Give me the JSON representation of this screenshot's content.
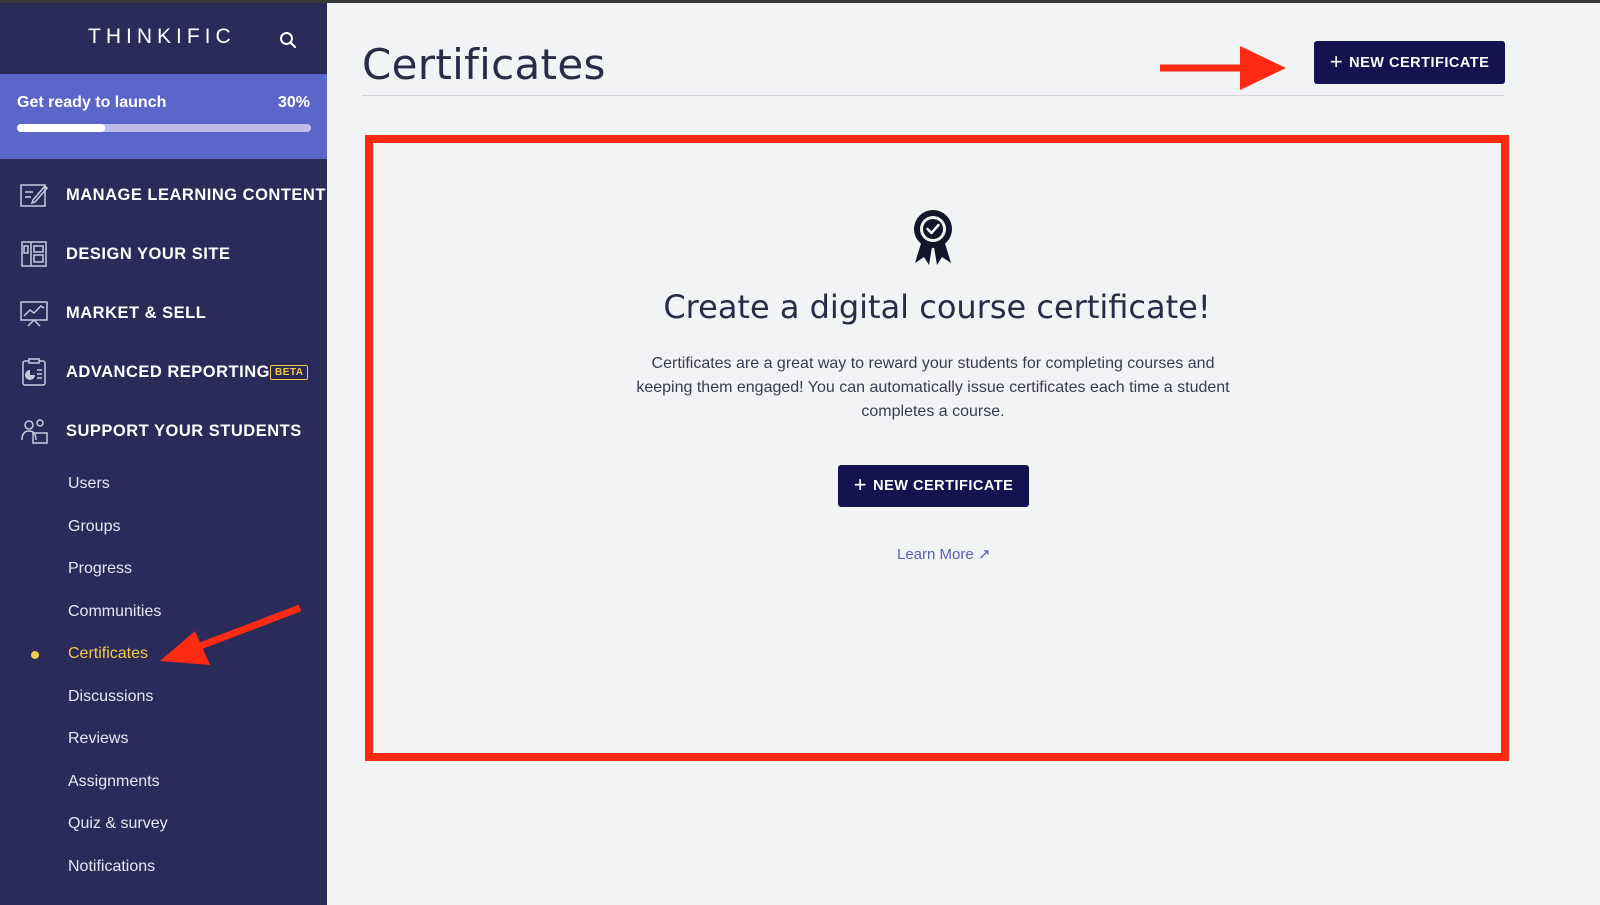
{
  "brand": "THINKIFIC",
  "launch": {
    "label": "Get ready to launch",
    "percent_text": "30%",
    "progress": 0.3
  },
  "nav": {
    "items": [
      {
        "label": "MANAGE LEARNING CONTENT",
        "icon": "edit-content-icon"
      },
      {
        "label": "DESIGN YOUR SITE",
        "icon": "layout-icon"
      },
      {
        "label": "MARKET & SELL",
        "icon": "chart-presentation-icon"
      },
      {
        "label": "ADVANCED REPORTING",
        "icon": "clipboard-report-icon",
        "badge": "BETA"
      },
      {
        "label": "SUPPORT YOUR STUDENTS",
        "icon": "students-icon"
      }
    ]
  },
  "subnav": {
    "items": [
      {
        "label": "Users"
      },
      {
        "label": "Groups"
      },
      {
        "label": "Progress"
      },
      {
        "label": "Communities"
      },
      {
        "label": "Certificates",
        "active": true
      },
      {
        "label": "Discussions"
      },
      {
        "label": "Reviews"
      },
      {
        "label": "Assignments"
      },
      {
        "label": "Quiz & survey"
      },
      {
        "label": "Notifications"
      }
    ]
  },
  "main": {
    "title": "Certificates",
    "new_button_label": "NEW CERTIFICATE",
    "empty_state": {
      "icon": "award-ribbon-icon",
      "heading": "Create a digital course certificate!",
      "description": "Certificates are a great way to reward your students for completing courses and keeping them engaged! You can automatically issue certificates each time a student completes a course.",
      "button_label": "NEW CERTIFICATE",
      "learn_more": "Learn More ↗"
    }
  },
  "colors": {
    "sidebar_bg": "#2a2b58",
    "launch_bg": "#5b67c8",
    "active_accent": "#f3c94b",
    "primary_button": "#14134f",
    "annotation_red": "#ff2a14",
    "link": "#5661b8"
  }
}
